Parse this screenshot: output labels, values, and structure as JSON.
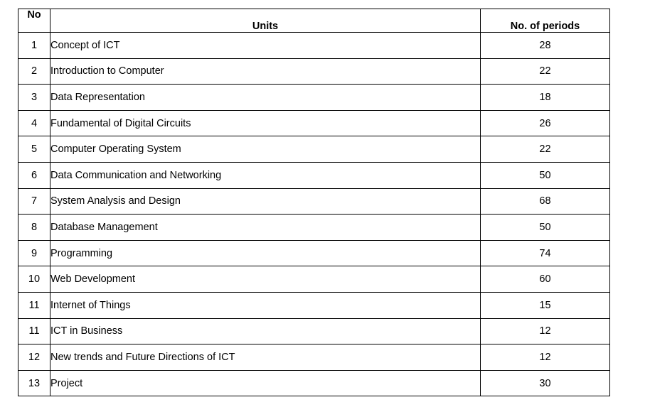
{
  "table": {
    "headers": {
      "no": "No",
      "units": "Units",
      "periods": "No. of periods"
    },
    "rows": [
      {
        "no": "1",
        "unit": "Concept of ICT",
        "periods": "28"
      },
      {
        "no": "2",
        "unit": "Introduction to Computer",
        "periods": "22"
      },
      {
        "no": "3",
        "unit": "Data Representation",
        "periods": "18"
      },
      {
        "no": "4",
        "unit": "Fundamental of Digital Circuits",
        "periods": "26"
      },
      {
        "no": "5",
        "unit": "Computer Operating System",
        "periods": "22"
      },
      {
        "no": "6",
        "unit": "Data Communication and Networking",
        "periods": "50"
      },
      {
        "no": "7",
        "unit": "System Analysis and Design",
        "periods": "68"
      },
      {
        "no": "8",
        "unit": "Database Management",
        "periods": "50"
      },
      {
        "no": "9",
        "unit": "Programming",
        "periods": "74"
      },
      {
        "no": "10",
        "unit": "Web Development",
        "periods": "60"
      },
      {
        "no": "11",
        "unit": "Internet of Things",
        "periods": "15"
      },
      {
        "no": "11",
        "unit": "ICT in Business",
        "periods": "12"
      },
      {
        "no": "12",
        "unit": "New trends and Future Directions of ICT",
        "periods": "12"
      },
      {
        "no": "13",
        "unit": "Project",
        "periods": "30"
      }
    ]
  }
}
